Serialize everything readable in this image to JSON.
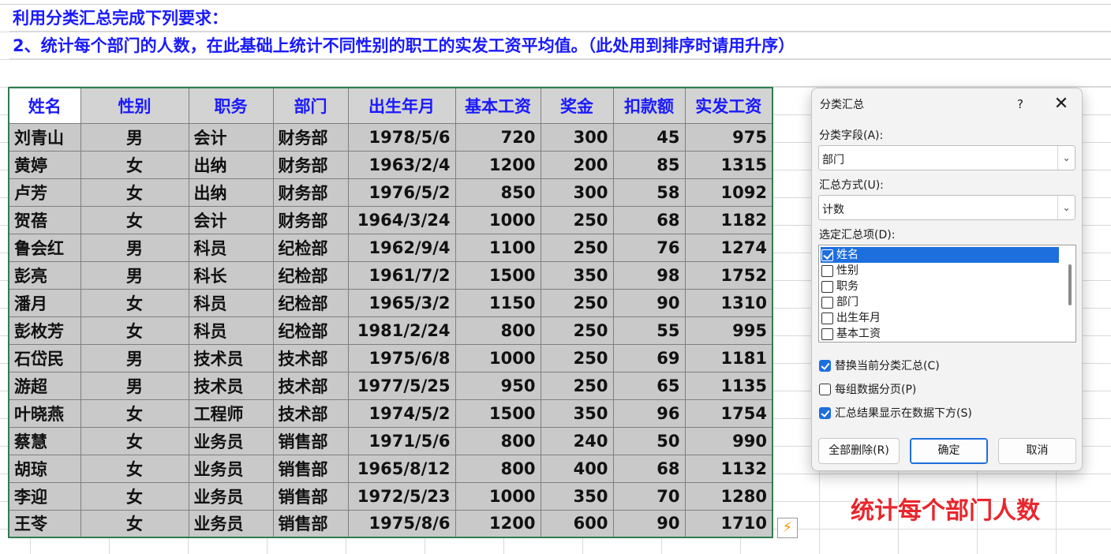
{
  "instructions": {
    "line1": "利用分类汇总完成下列要求：",
    "line2": "2、统计每个部门的人数，在此基础上统计不同性别的职工的实发工资平均值。（此处用到排序时请用升序）"
  },
  "table": {
    "headers": [
      "姓名",
      "性别",
      "职务",
      "部门",
      "出生年月",
      "基本工资",
      "奖金",
      "扣款额",
      "实发工资"
    ],
    "rows": [
      [
        "刘青山",
        "男",
        "会计",
        "财务部",
        "1978/5/6",
        "720",
        "300",
        "45",
        "975"
      ],
      [
        "黄婷",
        "女",
        "出纳",
        "财务部",
        "1963/2/4",
        "1200",
        "200",
        "85",
        "1315"
      ],
      [
        "卢芳",
        "女",
        "出纳",
        "财务部",
        "1976/5/2",
        "850",
        "300",
        "58",
        "1092"
      ],
      [
        "贺蓓",
        "女",
        "会计",
        "财务部",
        "1964/3/24",
        "1000",
        "250",
        "68",
        "1182"
      ],
      [
        "鲁会红",
        "男",
        "科员",
        "纪检部",
        "1962/9/4",
        "1100",
        "250",
        "76",
        "1274"
      ],
      [
        "彭亮",
        "男",
        "科长",
        "纪检部",
        "1961/7/2",
        "1500",
        "350",
        "98",
        "1752"
      ],
      [
        "潘月",
        "女",
        "科员",
        "纪检部",
        "1965/3/2",
        "1150",
        "250",
        "90",
        "1310"
      ],
      [
        "彭枚芳",
        "女",
        "科员",
        "纪检部",
        "1981/2/24",
        "800",
        "250",
        "55",
        "995"
      ],
      [
        "石岱民",
        "男",
        "技术员",
        "技术部",
        "1975/6/8",
        "1000",
        "250",
        "69",
        "1181"
      ],
      [
        "游超",
        "男",
        "技术员",
        "技术部",
        "1977/5/25",
        "950",
        "250",
        "65",
        "1135"
      ],
      [
        "叶晓燕",
        "女",
        "工程师",
        "技术部",
        "1974/5/2",
        "1500",
        "350",
        "96",
        "1754"
      ],
      [
        "蔡慧",
        "女",
        "业务员",
        "销售部",
        "1971/5/6",
        "800",
        "240",
        "50",
        "990"
      ],
      [
        "胡琼",
        "女",
        "业务员",
        "销售部",
        "1965/8/12",
        "800",
        "400",
        "68",
        "1132"
      ],
      [
        "李迎",
        "女",
        "业务员",
        "销售部",
        "1972/5/23",
        "1000",
        "350",
        "70",
        "1280"
      ],
      [
        "王苓",
        "女",
        "业务员",
        "销售部",
        "1975/8/6",
        "1200",
        "600",
        "90",
        "1710"
      ]
    ]
  },
  "dialog": {
    "title": "分类汇总",
    "help": "?",
    "close": "✕",
    "group_field_label": "分类字段(A):",
    "group_field_value": "部门",
    "function_label": "汇总方式(U):",
    "function_value": "计数",
    "add_subtotal_label": "选定汇总项(D):",
    "items": [
      {
        "label": "姓名",
        "checked": true
      },
      {
        "label": "性别",
        "checked": false
      },
      {
        "label": "职务",
        "checked": false
      },
      {
        "label": "部门",
        "checked": false
      },
      {
        "label": "出生年月",
        "checked": false
      },
      {
        "label": "基本工资",
        "checked": false
      }
    ],
    "options": [
      {
        "label": "替换当前分类汇总(C)",
        "checked": true
      },
      {
        "label": "每组数据分页(P)",
        "checked": false
      },
      {
        "label": "汇总结果显示在数据下方(S)",
        "checked": true
      }
    ],
    "buttons": {
      "remove_all": "全部删除(R)",
      "ok": "确定",
      "cancel": "取消"
    }
  },
  "annotation": "统计每个部门人数",
  "quick_analysis_icon": "lightning-icon"
}
